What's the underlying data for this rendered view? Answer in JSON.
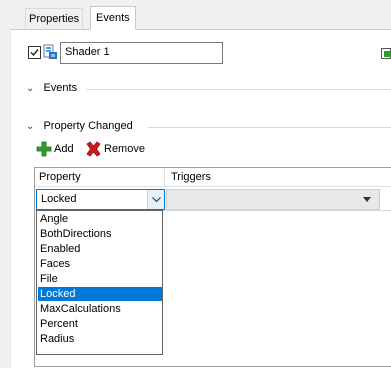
{
  "tabs": [
    {
      "label": "Properties",
      "active": false
    },
    {
      "label": "Events",
      "active": true
    }
  ],
  "object": {
    "enabled": true,
    "name": "Shader 1",
    "icon": "shader-object-icon"
  },
  "sections": {
    "events": {
      "label": "Events",
      "expanded": false
    },
    "property_changed": {
      "label": "Property Changed",
      "expanded": true
    }
  },
  "toolbar": {
    "add_label": "Add",
    "remove_label": "Remove",
    "add_icon": "green-plus-icon",
    "remove_icon": "red-x-icon"
  },
  "grid": {
    "columns": [
      "Property",
      "Triggers"
    ],
    "row": {
      "property": "Locked",
      "triggers": ""
    }
  },
  "dropdown": {
    "options": [
      "Angle",
      "BothDirections",
      "Enabled",
      "Faces",
      "File",
      "Locked",
      "MaxCalculations",
      "Percent",
      "Radius"
    ],
    "selected": "Locked"
  },
  "colors": {
    "selection": "#0078d7",
    "add_icon": "#2e9e2e",
    "remove_icon": "#d01818"
  }
}
